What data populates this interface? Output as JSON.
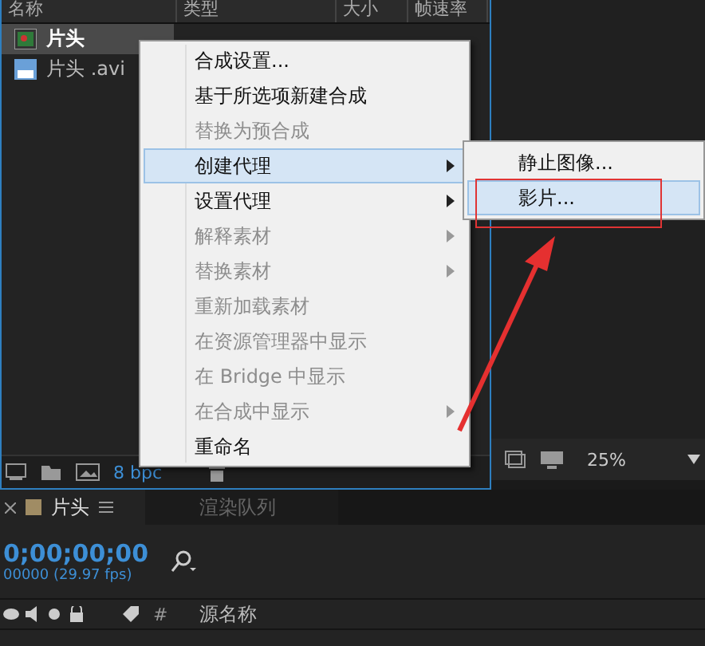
{
  "project": {
    "columns": [
      "名称",
      "类型",
      "大小",
      "帧速率"
    ],
    "items": [
      {
        "name": "片头",
        "kind": "comp",
        "selected": true
      },
      {
        "name": "片头 .avi",
        "kind": "footage",
        "selected": false
      }
    ],
    "bit_depth": "8 bpc"
  },
  "context_menu": {
    "items": [
      {
        "label": "合成设置...",
        "disabled": false,
        "selected": false,
        "submenu": false
      },
      {
        "label": "基于所选项新建合成",
        "disabled": false,
        "selected": false,
        "submenu": false
      },
      {
        "label": "替换为预合成",
        "disabled": true,
        "selected": false,
        "submenu": false
      },
      {
        "label": "创建代理",
        "disabled": false,
        "selected": true,
        "submenu": true
      },
      {
        "label": "设置代理",
        "disabled": false,
        "selected": false,
        "submenu": true
      },
      {
        "label": "解释素材",
        "disabled": true,
        "selected": false,
        "submenu": true
      },
      {
        "label": "替换素材",
        "disabled": true,
        "selected": false,
        "submenu": true
      },
      {
        "label": "重新加载素材",
        "disabled": true,
        "selected": false,
        "submenu": false
      },
      {
        "label": "在资源管理器中显示",
        "disabled": true,
        "selected": false,
        "submenu": false
      },
      {
        "label": "在 Bridge 中显示",
        "disabled": true,
        "selected": false,
        "submenu": false
      },
      {
        "label": "在合成中显示",
        "disabled": true,
        "selected": false,
        "submenu": true
      },
      {
        "label": "重命名",
        "disabled": false,
        "selected": false,
        "submenu": false
      }
    ]
  },
  "submenu": {
    "items": [
      {
        "label": "静止图像...",
        "selected": false
      },
      {
        "label": "影片...",
        "selected": true
      }
    ]
  },
  "viewer": {
    "zoom": "25%"
  },
  "timeline": {
    "tabs": [
      {
        "label": "片头",
        "selected": true,
        "closable": true
      },
      {
        "label": "渲染队列",
        "selected": false,
        "closable": false
      }
    ],
    "timecode": "0;00;00;00",
    "frame_info": "00000 (29.97 fps)",
    "columns": [
      "#",
      "源名称"
    ]
  }
}
